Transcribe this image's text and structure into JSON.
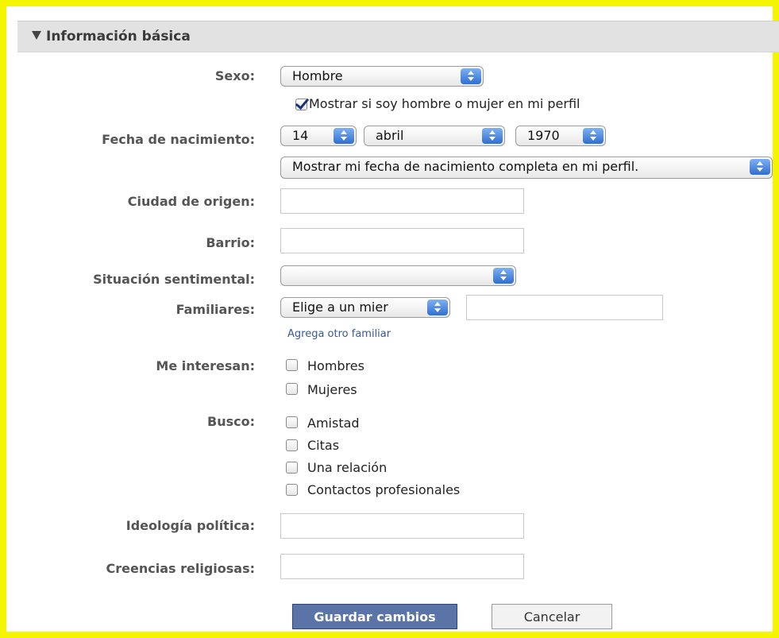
{
  "section": {
    "title": "Información básica"
  },
  "sexo": {
    "label": "Sexo:",
    "value": "Hombre",
    "show_checkbox": {
      "label": "Mostrar si soy hombre o mujer en mi perfil",
      "checked": true
    }
  },
  "birthdate": {
    "label": "Fecha de nacimiento:",
    "day": "14",
    "month": "abril",
    "year": "1970",
    "visibility": "Mostrar mi fecha de nacimiento completa en mi perfil."
  },
  "hometown": {
    "label": "Ciudad de origen:",
    "value": ""
  },
  "neighborhood": {
    "label": "Barrio:",
    "value": ""
  },
  "relationship": {
    "label": "Situación sentimental:",
    "value": ""
  },
  "family": {
    "label": "Familiares:",
    "member_select": "Elige a un mier",
    "name_value": "",
    "add_link": "Agrega otro familiar"
  },
  "interested_in": {
    "label": "Me interesan:",
    "options": [
      {
        "label": "Hombres",
        "checked": false
      },
      {
        "label": "Mujeres",
        "checked": false
      }
    ]
  },
  "looking_for": {
    "label": "Busco:",
    "options": [
      {
        "label": "Amistad",
        "checked": false
      },
      {
        "label": "Citas",
        "checked": false
      },
      {
        "label": "Una relación",
        "checked": false
      },
      {
        "label": "Contactos profesionales",
        "checked": false
      }
    ]
  },
  "political": {
    "label": "Ideología política:",
    "value": ""
  },
  "religious": {
    "label": "Creencias religiosas:",
    "value": ""
  },
  "buttons": {
    "save": "Guardar cambios",
    "cancel": "Cancelar"
  },
  "colors": {
    "frame": "#f5f500",
    "save_button": "#5b74a8",
    "link": "#3b5998",
    "select_arrow": "#2f6fd0"
  }
}
